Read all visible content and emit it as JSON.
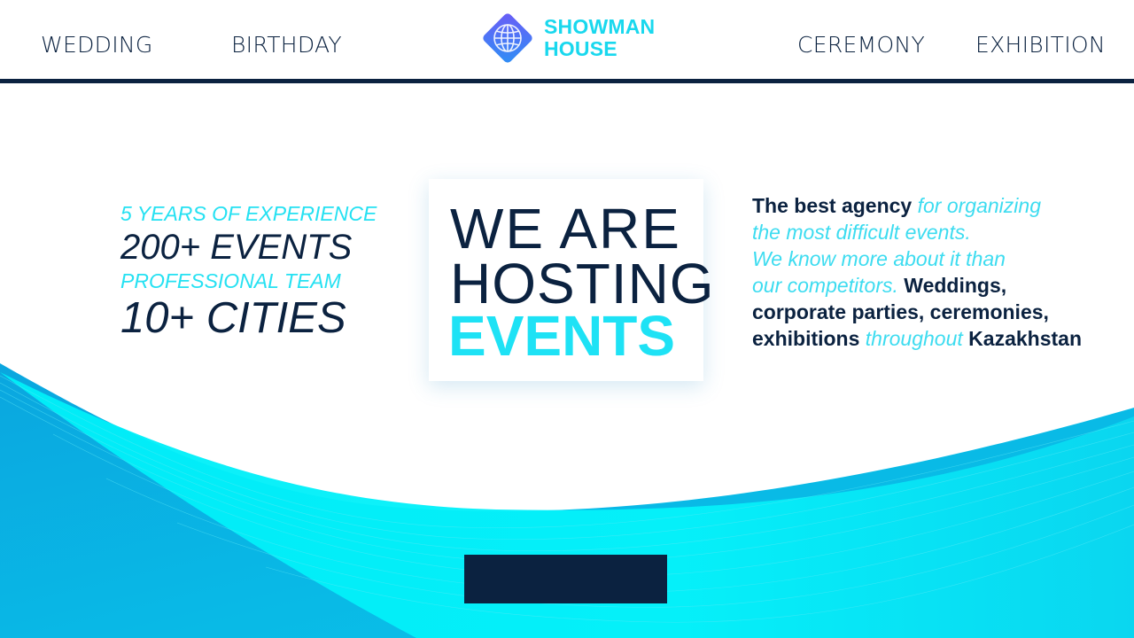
{
  "header": {
    "nav_left": [
      "WEDDING",
      "BIRTHDAY"
    ],
    "nav_right": [
      "CEREMONY",
      "EXHIBITION"
    ],
    "logo": {
      "line1": "SHOWMAN",
      "line2": "HOUSE"
    }
  },
  "stats": {
    "experience": "5 YEARS OF EXPERIENCE",
    "events": "200+ EVENTS",
    "team": "PROFESSIONAL TEAM",
    "cities": "10+ CITIES"
  },
  "hero_card": {
    "line1": "WE ARE",
    "line2": "HOSTING",
    "line3": "EVENTS"
  },
  "description": {
    "l1_strong": "The best agency",
    "l1_light": " for organizing",
    "l2_light": " the most difficult events.",
    "l3_light": " We know more about it than",
    "l4_light": "our competitors. ",
    "l4_strong": "Weddings,",
    "l5_strong": " corporate parties, ceremonies,",
    "l6_strong": " exhibitions",
    "l6_light": " throughout ",
    "l6_strong2": "Kazakhstan"
  },
  "colors": {
    "navy": "#0b2240",
    "cyan": "#1ee2f5",
    "wave_dark": "#0aa8e0",
    "wave_light": "#00f0f8"
  },
  "icons": {
    "logo_mark": "globe-diamond-icon"
  }
}
